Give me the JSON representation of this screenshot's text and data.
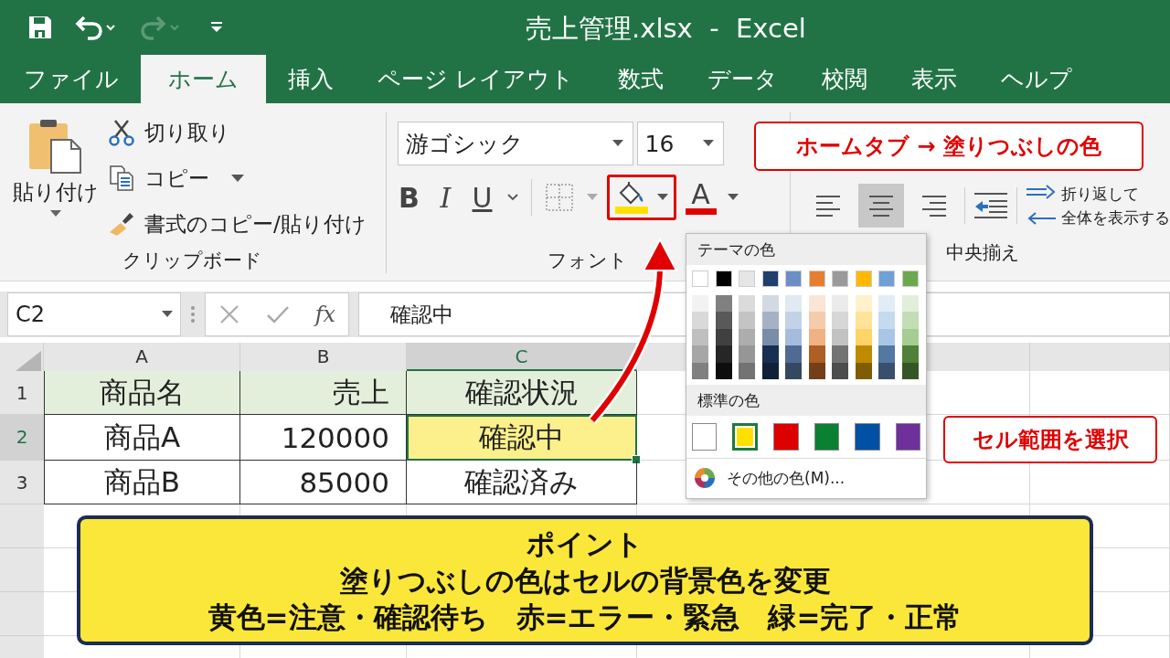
{
  "window": {
    "title": "売上管理.xlsx  -  Excel"
  },
  "quick_access": [
    {
      "kind": "save",
      "disabled": false
    },
    {
      "kind": "undo",
      "disabled": false
    },
    {
      "kind": "redo",
      "disabled": true
    },
    {
      "kind": "customize",
      "disabled": false
    }
  ],
  "tabs": [
    {
      "label": "ファイル",
      "selected": false
    },
    {
      "label": "ホーム",
      "selected": true
    },
    {
      "label": "挿入",
      "selected": false
    },
    {
      "label": "ページ レイアウト",
      "selected": false
    },
    {
      "label": "数式",
      "selected": false
    },
    {
      "label": "データ",
      "selected": false
    },
    {
      "label": "校閲",
      "selected": false
    },
    {
      "label": "表示",
      "selected": false
    },
    {
      "label": "ヘルプ",
      "selected": false
    }
  ],
  "clipboard": {
    "paste": "貼り付け",
    "cut": "切り取り",
    "copy": "コピー",
    "format_painter": "書式のコピー/貼り付け",
    "group_label": "クリップボード"
  },
  "font": {
    "name": "游ゴシック",
    "size": "16",
    "bold": "B",
    "italic": "I",
    "underline": "U",
    "font_color": {
      "label": "A",
      "color": "#e00000"
    },
    "fill_color": {
      "color": "#ffe000"
    },
    "group_label": "フォント"
  },
  "alignment": {
    "buttons": [
      {
        "kind": "left",
        "selected": false
      },
      {
        "kind": "center",
        "selected": true
      },
      {
        "kind": "right",
        "selected": false
      }
    ],
    "label": "中央揃え",
    "wrap_text": [
      "折り返して",
      "全体を表示する"
    ]
  },
  "formula_bar": {
    "name_box": "C2",
    "fx": "fx",
    "value": "確認中"
  },
  "sheet": {
    "columns": [
      {
        "label": "A",
        "selected": false
      },
      {
        "label": "B",
        "selected": false
      },
      {
        "label": "C",
        "selected": true
      }
    ],
    "rows": [
      {
        "number": "1",
        "selected": false,
        "cells": [
          {
            "text": "商品名",
            "color": "#e3efdb",
            "selected": false
          },
          {
            "text": "売上",
            "color": "#e3efdb",
            "selected": false
          },
          {
            "text": "確認状況",
            "color": "#e3efdb",
            "selected": false
          }
        ]
      },
      {
        "number": "2",
        "selected": true,
        "cells": [
          {
            "text": "商品A",
            "selected": false
          },
          {
            "text": "120000",
            "selected": false
          },
          {
            "text": "確認中",
            "color": "#fcf08c",
            "selected": true
          }
        ]
      },
      {
        "number": "3",
        "selected": false,
        "cells": [
          {
            "text": "商品B",
            "selected": false
          },
          {
            "text": "85000",
            "selected": false
          },
          {
            "text": "確認済み",
            "selected": false
          }
        ]
      }
    ]
  },
  "color_picker": {
    "theme_title": "テーマの色",
    "theme_colors": [
      {
        "color": "#ffffff"
      },
      {
        "color": "#000000"
      },
      {
        "color": "#e7e6e6"
      },
      {
        "color": "#1f3f6e"
      },
      {
        "color": "#6a8fc4"
      },
      {
        "color": "#e67e30"
      },
      {
        "color": "#9a9a9a"
      },
      {
        "color": "#ffb800"
      },
      {
        "color": "#6fa0d6"
      },
      {
        "color": "#6aaa4c"
      }
    ],
    "standard_title": "標準の色",
    "standard_colors": [
      {
        "color": "#ffffff",
        "selected": false
      },
      {
        "color": "#ffe000",
        "selected": true
      },
      {
        "color": "#dd0000",
        "selected": false
      },
      {
        "color": "#0a8032",
        "selected": false
      },
      {
        "color": "#0050a4",
        "selected": false
      },
      {
        "color": "#70309c",
        "selected": false
      }
    ],
    "more_colors": "その他の色(M)..."
  },
  "annotations": [
    {
      "kind": "callout",
      "text": "ホームタブ → 塗りつぶしの色"
    },
    {
      "kind": "callout",
      "text": "セル範囲を選択"
    }
  ],
  "point_box": {
    "title": "ポイント",
    "lines": [
      "塗りつぶしの色はセルの背景色を変更",
      "黄色=注意・確認待ち　赤=エラー・緊急　緑=完了・正常"
    ]
  }
}
